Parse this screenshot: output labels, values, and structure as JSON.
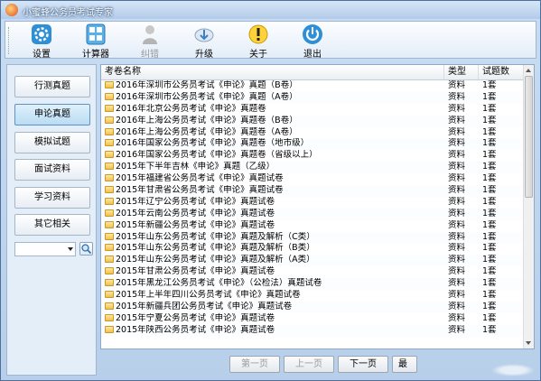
{
  "window": {
    "title": "小蜜蜂公务员考试专家"
  },
  "toolbar": {
    "items": [
      {
        "label": "设置",
        "icon": "gear-icon",
        "enabled": true
      },
      {
        "label": "计算器",
        "icon": "calculator-icon",
        "enabled": true
      },
      {
        "label": "纠错",
        "icon": "person-icon",
        "enabled": false
      },
      {
        "label": "升级",
        "icon": "cloud-download-icon",
        "enabled": true
      },
      {
        "label": "关于",
        "icon": "info-exclamation-icon",
        "enabled": true
      },
      {
        "label": "退出",
        "icon": "power-icon",
        "enabled": true
      }
    ]
  },
  "sidebar": {
    "items": [
      {
        "label": "行测真题",
        "active": false
      },
      {
        "label": "申论真题",
        "active": true
      },
      {
        "label": "模拟试题",
        "active": false
      },
      {
        "label": "面试资料",
        "active": false
      },
      {
        "label": "学习资料",
        "active": false
      },
      {
        "label": "其它相关",
        "active": false
      }
    ],
    "combo_value": ""
  },
  "table": {
    "headers": {
      "name": "考卷名称",
      "type": "类型",
      "count": "试题数"
    },
    "rows": [
      {
        "name": "2016年深圳市公务员考试《申论》真题（B卷）",
        "type": "资料",
        "count": "1套"
      },
      {
        "name": "2016年深圳市公务员考试《申论》真题（A卷）",
        "type": "资料",
        "count": "1套"
      },
      {
        "name": "2016年北京公务员考试《申论》真题卷",
        "type": "资料",
        "count": "1套"
      },
      {
        "name": "2016年上海公务员考试《申论》真题卷（B卷）",
        "type": "资料",
        "count": "1套"
      },
      {
        "name": "2016年上海公务员考试《申论》真题卷（A卷）",
        "type": "资料",
        "count": "1套"
      },
      {
        "name": "2016年国家公务员考试《申论》真题卷（地市级）",
        "type": "资料",
        "count": "1套"
      },
      {
        "name": "2016年国家公务员考试《申论》真题卷（省级以上）",
        "type": "资料",
        "count": "1套"
      },
      {
        "name": "2015年下半年吉林《申论》真题（乙级）",
        "type": "资料",
        "count": "1套"
      },
      {
        "name": "2015年福建省公务员考试《申论》真题试卷",
        "type": "资料",
        "count": "1套"
      },
      {
        "name": "2015年甘肃省公务员考试《申论》真题试卷",
        "type": "资料",
        "count": "1套"
      },
      {
        "name": "2015年辽宁公务员考试《申论》真题试卷",
        "type": "资料",
        "count": "1套"
      },
      {
        "name": "2015年云南公务员考试《申论》真题试卷",
        "type": "资料",
        "count": "1套"
      },
      {
        "name": "2015年新疆公务员考试《申论》真题试卷",
        "type": "资料",
        "count": "1套"
      },
      {
        "name": "2015年山东公务员考试《申论》真题及解析（C类）",
        "type": "资料",
        "count": "1套"
      },
      {
        "name": "2015年山东公务员考试《申论》真题及解析（B类）",
        "type": "资料",
        "count": "1套"
      },
      {
        "name": "2015年山东公务员考试《申论》真题及解析（A类）",
        "type": "资料",
        "count": "1套"
      },
      {
        "name": "2015年甘肃公务员考试《申论》真题试卷",
        "type": "资料",
        "count": "1套"
      },
      {
        "name": "2015年黑龙江公务员考试《申论》（公检法）真题试卷",
        "type": "资料",
        "count": "1套"
      },
      {
        "name": "2015年上半年四川公务员考试《申论》真题试卷",
        "type": "资料",
        "count": "1套"
      },
      {
        "name": "2015年新疆兵团公务员考试《申论》真题试卷",
        "type": "资料",
        "count": "1套"
      },
      {
        "name": "2015年宁夏公务员考试《申论》真题试卷",
        "type": "资料",
        "count": "1套"
      },
      {
        "name": "2015年陕西公务员考试《申论》真题试卷",
        "type": "资料",
        "count": "1套"
      }
    ]
  },
  "pager": {
    "first": "第一页",
    "prev": "上一页",
    "next": "下一页",
    "last": "最"
  },
  "colors": {
    "accent": "#5f93c2",
    "folder": "#f1c14c"
  }
}
